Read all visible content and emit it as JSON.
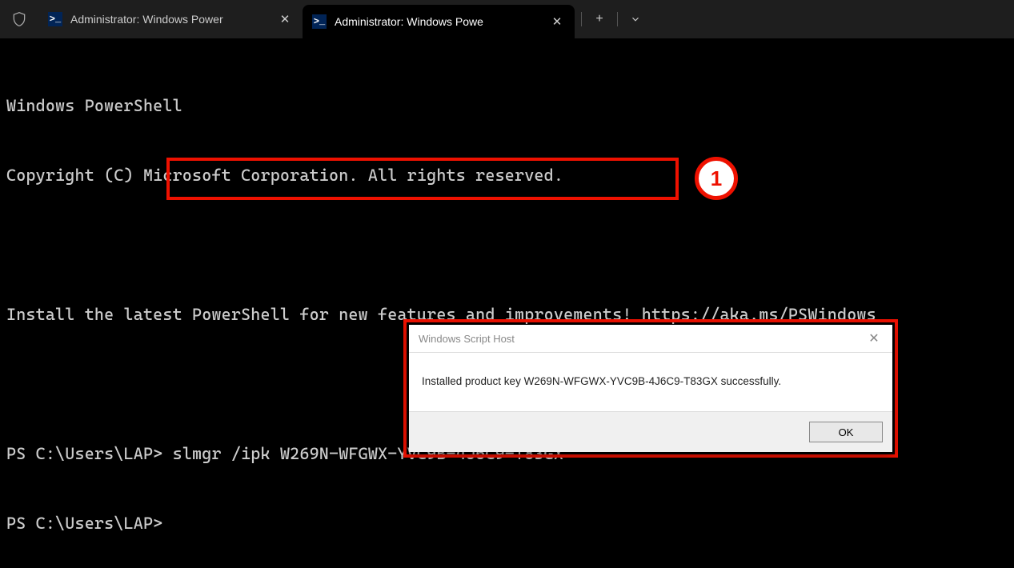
{
  "tabs": [
    {
      "title": "Administrator: Windows Power"
    },
    {
      "title": "Administrator: Windows Powe"
    }
  ],
  "terminal": {
    "header1": "Windows PowerShell",
    "header2": "Copyright (C) Microsoft Corporation. All rights reserved.",
    "installMsg": "Install the latest PowerShell for new features and improvements! https://aka.ms/PSWindows",
    "prompt1": "PS C:\\Users\\LAP> ",
    "cmd1": "slmgr /ipk W269N-WFGWX-YVC9B-4J6C9-T83GX",
    "prompt2": "PS C:\\Users\\LAP>"
  },
  "callout": {
    "num": "1"
  },
  "dialog": {
    "title": "Windows Script Host",
    "message": "Installed product key W269N-WFGWX-YVC9B-4J6C9-T83GX successfully.",
    "ok": "OK"
  },
  "controls": {
    "plus": "+",
    "chevron": "⌄"
  }
}
